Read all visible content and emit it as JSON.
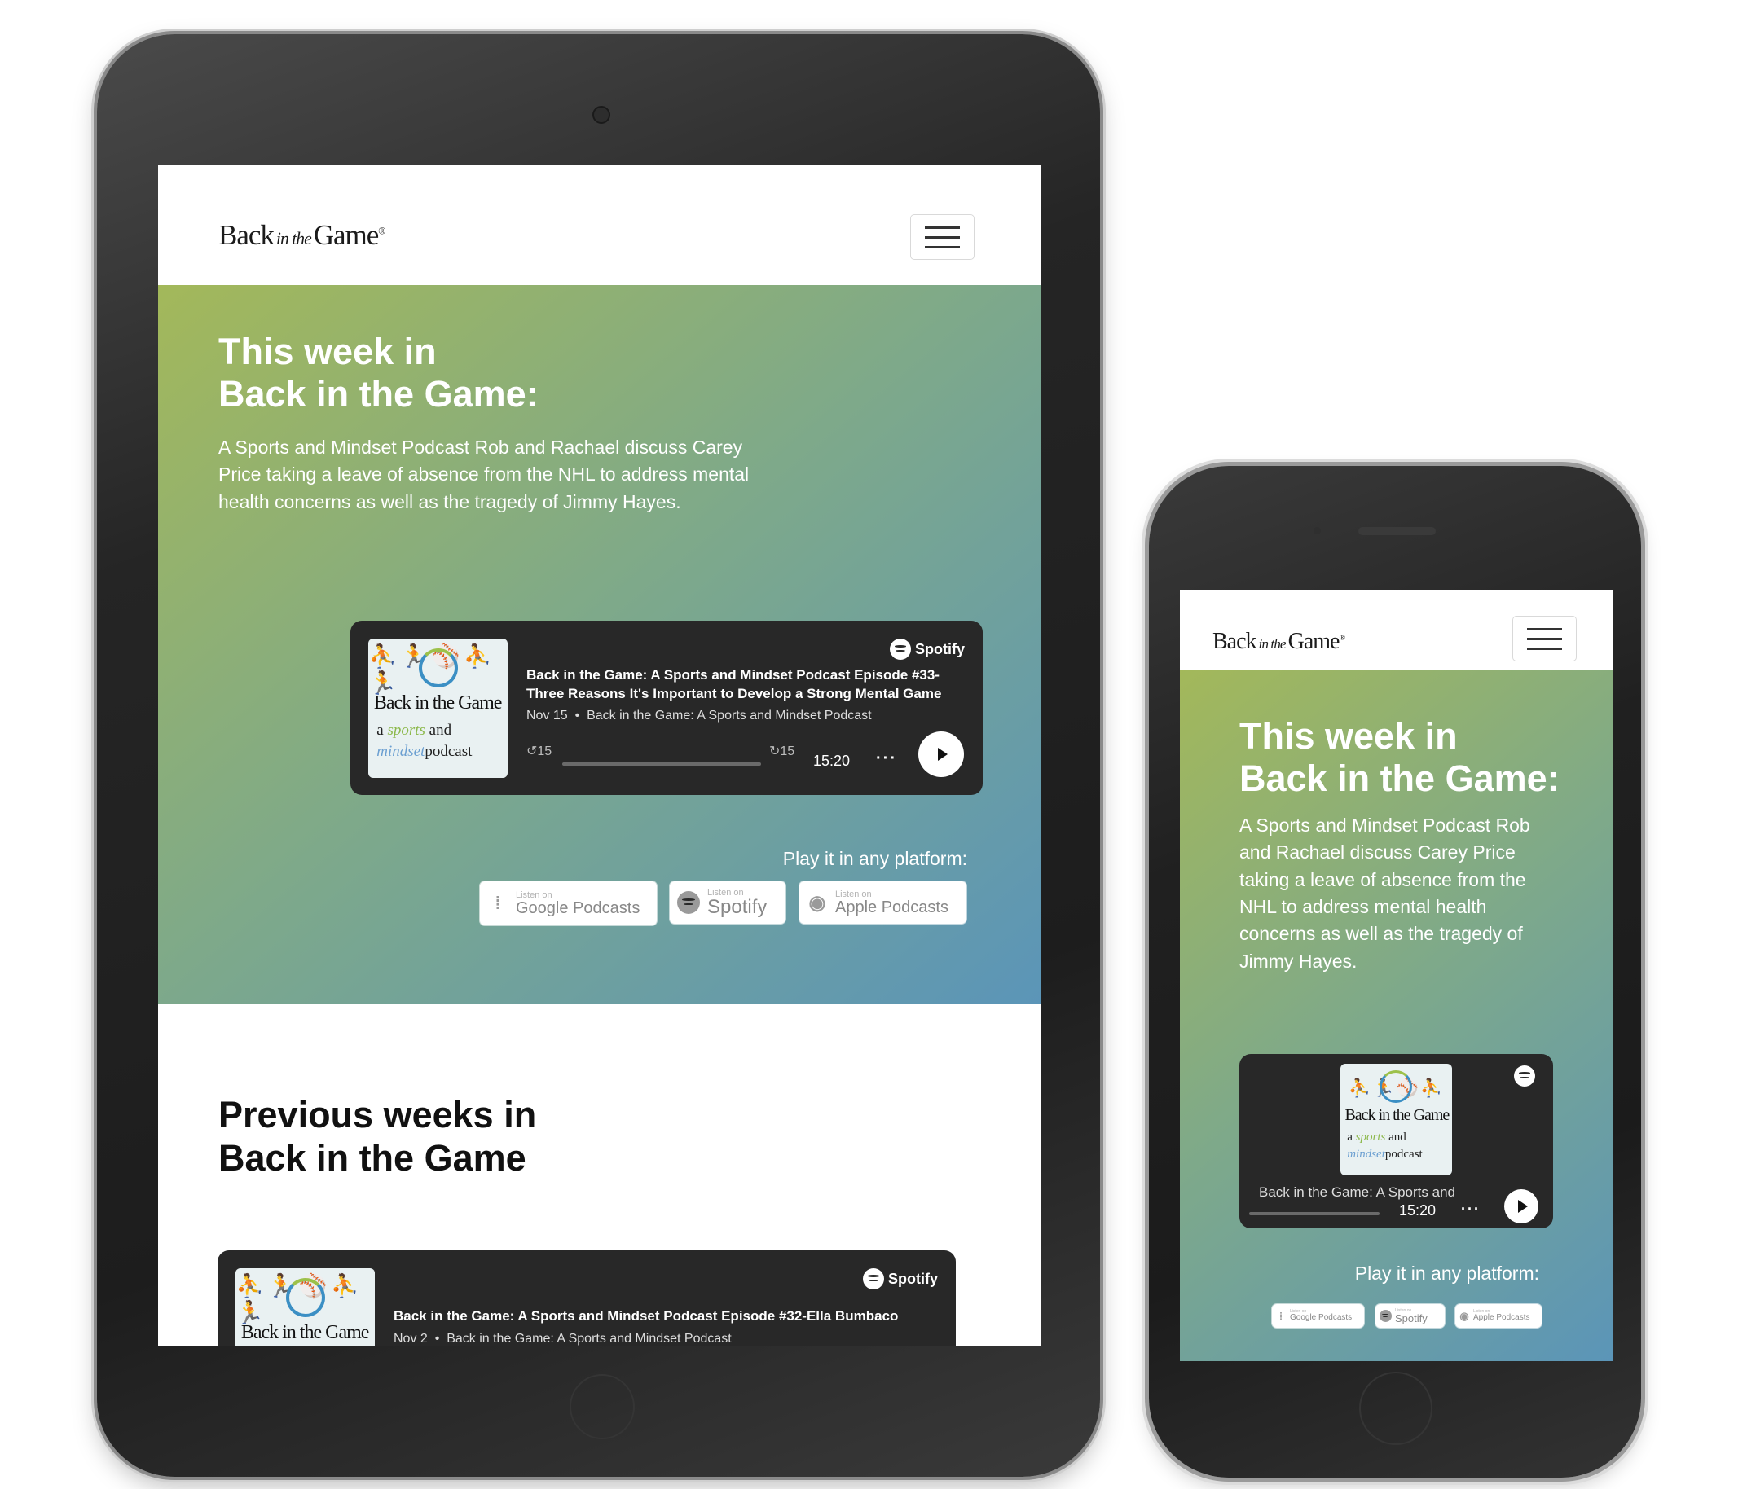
{
  "brand": {
    "logo_main": "Back",
    "logo_small": "in the",
    "logo_end": "Game",
    "logo_mark": "®"
  },
  "hero": {
    "title_line1": "This week in",
    "title_line2": "Back in the Game:",
    "description": "A Sports and Mindset Podcast Rob and Rachael discuss Carey Price taking a leave of absence from the NHL to address mental health concerns as well as the tragedy of Jimmy Hayes.",
    "platform_label": "Play it in any platform:"
  },
  "player_current": {
    "brand": "Spotify",
    "title": "Back in the Game: A Sports and Mindset Podcast Episode #33- Three Reasons It's Important to Develop a Strong Mental Game",
    "date": "Nov 15",
    "show": "Back in the Game: A Sports and Mindset Podcast",
    "skip_back": "15",
    "skip_fwd": "15",
    "duration": "15:20",
    "more": "···"
  },
  "cover": {
    "title": "Back in the Game",
    "sub_a": "a",
    "sub_sports": "sports",
    "sub_and": "and",
    "sub_mindset": "mindset",
    "sub_podcast": "podcast"
  },
  "platforms": [
    {
      "small": "Listen on",
      "label": "Google Podcasts",
      "icon": "google-podcasts-icon"
    },
    {
      "small": "Listen on",
      "label": "Spotify",
      "icon": "spotify-icon"
    },
    {
      "small": "Listen on",
      "label": "Apple Podcasts",
      "icon": "apple-podcasts-icon"
    }
  ],
  "previous": {
    "title_line1": "Previous weeks in",
    "title_line2": "Back in the Game",
    "player": {
      "brand": "Spotify",
      "title": "Back in the Game: A Sports and Mindset Podcast Episode #32-Ella Bumbaco",
      "date": "Nov 2",
      "show": "Back in the Game: A Sports and Mindset Podcast"
    }
  },
  "phone": {
    "player_show": "Back in the Game: A Sports and",
    "duration": "15:20",
    "more": "···"
  },
  "colors": {
    "hero_start": "#a3b85a",
    "hero_end": "#5b95b8",
    "player_bg": "#282828"
  }
}
